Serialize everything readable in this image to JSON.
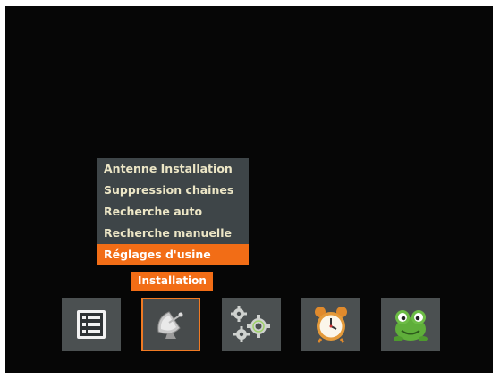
{
  "submenu": {
    "items": [
      {
        "label": "Antenne Installation",
        "selected": false
      },
      {
        "label": "Suppression chaines",
        "selected": false
      },
      {
        "label": "Recherche auto",
        "selected": false
      },
      {
        "label": "Recherche manuelle",
        "selected": false
      },
      {
        "label": "Réglages d'usine",
        "selected": true
      }
    ]
  },
  "toolbar": {
    "active_label": "Installation",
    "items": [
      {
        "icon": "channel-list-icon",
        "active": false
      },
      {
        "icon": "satellite-dish-icon",
        "active": true
      },
      {
        "icon": "gears-icon",
        "active": false
      },
      {
        "icon": "alarm-clock-icon",
        "active": false
      },
      {
        "icon": "frog-mascot-icon",
        "active": false
      }
    ]
  },
  "colors": {
    "background": "#060606",
    "menu_background": "#3e4548",
    "accent": "#f26d16",
    "menu_text": "#ece6c6",
    "tile_background": "#4b5051"
  }
}
